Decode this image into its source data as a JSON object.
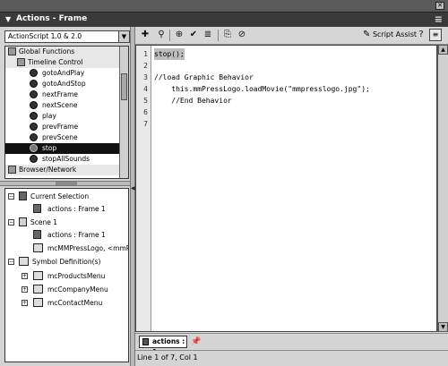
{
  "window": {
    "close_glyph": "✕"
  },
  "panel": {
    "title": "Actions - Frame",
    "collapse_glyph": "▼",
    "menu_glyph": "≡"
  },
  "toolbox": {
    "version_select": "ActionScript 1.0 & 2.0",
    "items": [
      {
        "label": "Global Functions",
        "kind": "category"
      },
      {
        "label": "Timeline Control",
        "kind": "category"
      },
      {
        "label": "gotoAndPlay",
        "kind": "item"
      },
      {
        "label": "gotoAndStop",
        "kind": "item"
      },
      {
        "label": "nextFrame",
        "kind": "item"
      },
      {
        "label": "nextScene",
        "kind": "item"
      },
      {
        "label": "play",
        "kind": "item"
      },
      {
        "label": "prevFrame",
        "kind": "item"
      },
      {
        "label": "prevScene",
        "kind": "item"
      },
      {
        "label": "stop",
        "kind": "selected"
      },
      {
        "label": "stopAllSounds",
        "kind": "item"
      },
      {
        "label": "Browser/Network",
        "kind": "category"
      }
    ]
  },
  "script_navigator": {
    "rows": [
      {
        "label": "Current Selection",
        "expander": "−"
      },
      {
        "label": "actions : Frame 1"
      },
      {
        "label": "Scene 1",
        "expander": "−"
      },
      {
        "label": "actions : Frame 1"
      },
      {
        "label": "mcMMPressLogo, <mmPr"
      },
      {
        "label": "Symbol Definition(s)",
        "expander": "−"
      },
      {
        "label": "mcProductsMenu",
        "expander": "+"
      },
      {
        "label": "mcCompanyMenu",
        "expander": "+"
      },
      {
        "label": "mcContactMenu",
        "expander": "+"
      }
    ]
  },
  "toolbar": {
    "add_glyph": "✚",
    "find_glyph": "⚲",
    "target_glyph": "⊕",
    "check_glyph": "✔",
    "format_glyph": "≣",
    "hints_glyph": "⎘",
    "debug_glyph": "⊘",
    "script_assist_label": "Script Assist",
    "script_assist_glyph": "✎",
    "help_glyph": "?",
    "view_options_glyph": "≡"
  },
  "editor": {
    "lines": [
      {
        "n": "1",
        "text": "stop();"
      },
      {
        "n": "2",
        "text": ""
      },
      {
        "n": "3",
        "text": "//load Graphic Behavior"
      },
      {
        "n": "4",
        "text": "    this.mmPressLogo.loadMovie(\"mmpresslogo.jpg\");"
      },
      {
        "n": "5",
        "text": "    //End Behavior"
      },
      {
        "n": "6",
        "text": ""
      },
      {
        "n": "7",
        "text": ""
      }
    ]
  },
  "tab": {
    "label": "actions : 1",
    "pin_glyph": "📌"
  },
  "status": {
    "text": "Line 1 of 7, Col 1"
  }
}
